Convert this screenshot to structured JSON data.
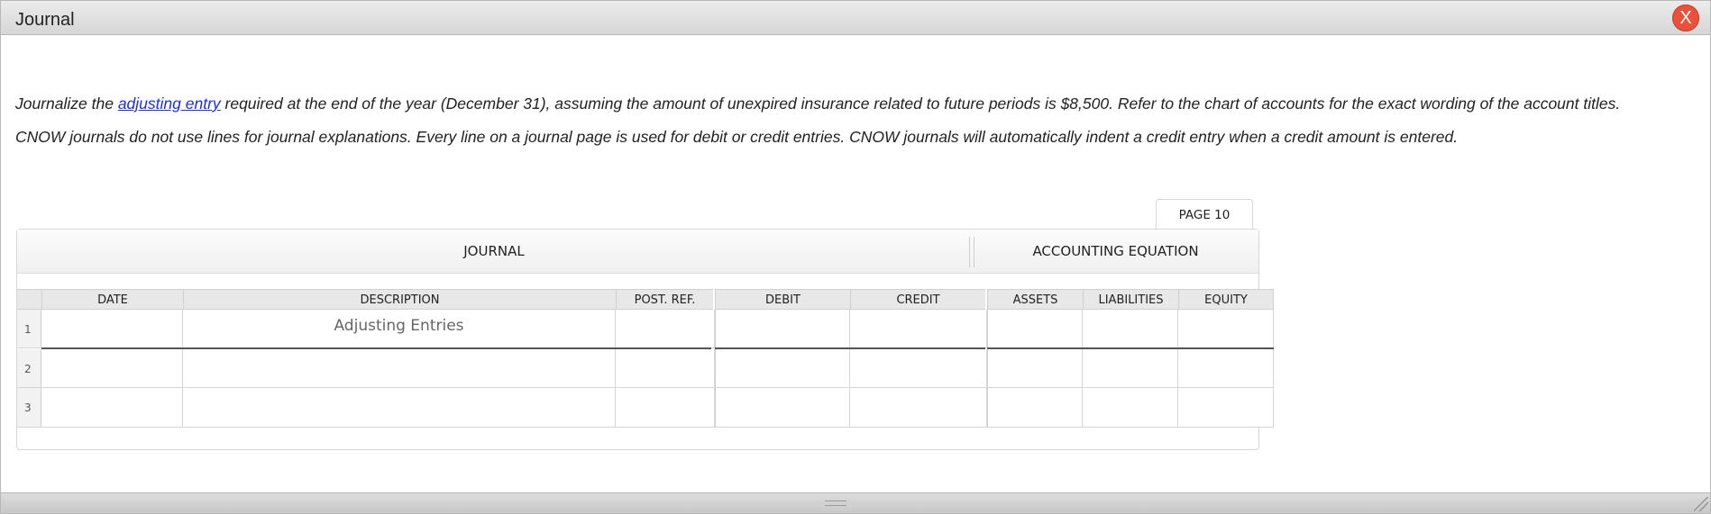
{
  "window": {
    "title": "Journal",
    "close_label": "X"
  },
  "instructions": {
    "line1_before": "Journalize the ",
    "link": "adjusting entry",
    "line1_after": " required at the end of the year (December 31), assuming the amount of unexpired insurance related to future periods is $8,500. Refer to the chart of accounts for the exact wording of the account titles.",
    "line2": "CNOW journals do not use lines for journal explanations. Every line on a journal page is used for debit or credit entries. CNOW journals will automatically indent a credit entry when a credit amount is entered."
  },
  "page_tab": "PAGE 10",
  "journal": {
    "section_journal": "JOURNAL",
    "section_equation": "ACCOUNTING EQUATION",
    "columns": {
      "date": "DATE",
      "description": "DESCRIPTION",
      "post_ref": "POST. REF.",
      "debit": "DEBIT",
      "credit": "CREDIT",
      "assets": "ASSETS",
      "liabilities": "LIABILITIES",
      "equity": "EQUITY"
    },
    "rows": [
      {
        "num": "1",
        "description": "Adjusting Entries"
      },
      {
        "num": "2",
        "description": ""
      },
      {
        "num": "3",
        "description": ""
      }
    ]
  }
}
